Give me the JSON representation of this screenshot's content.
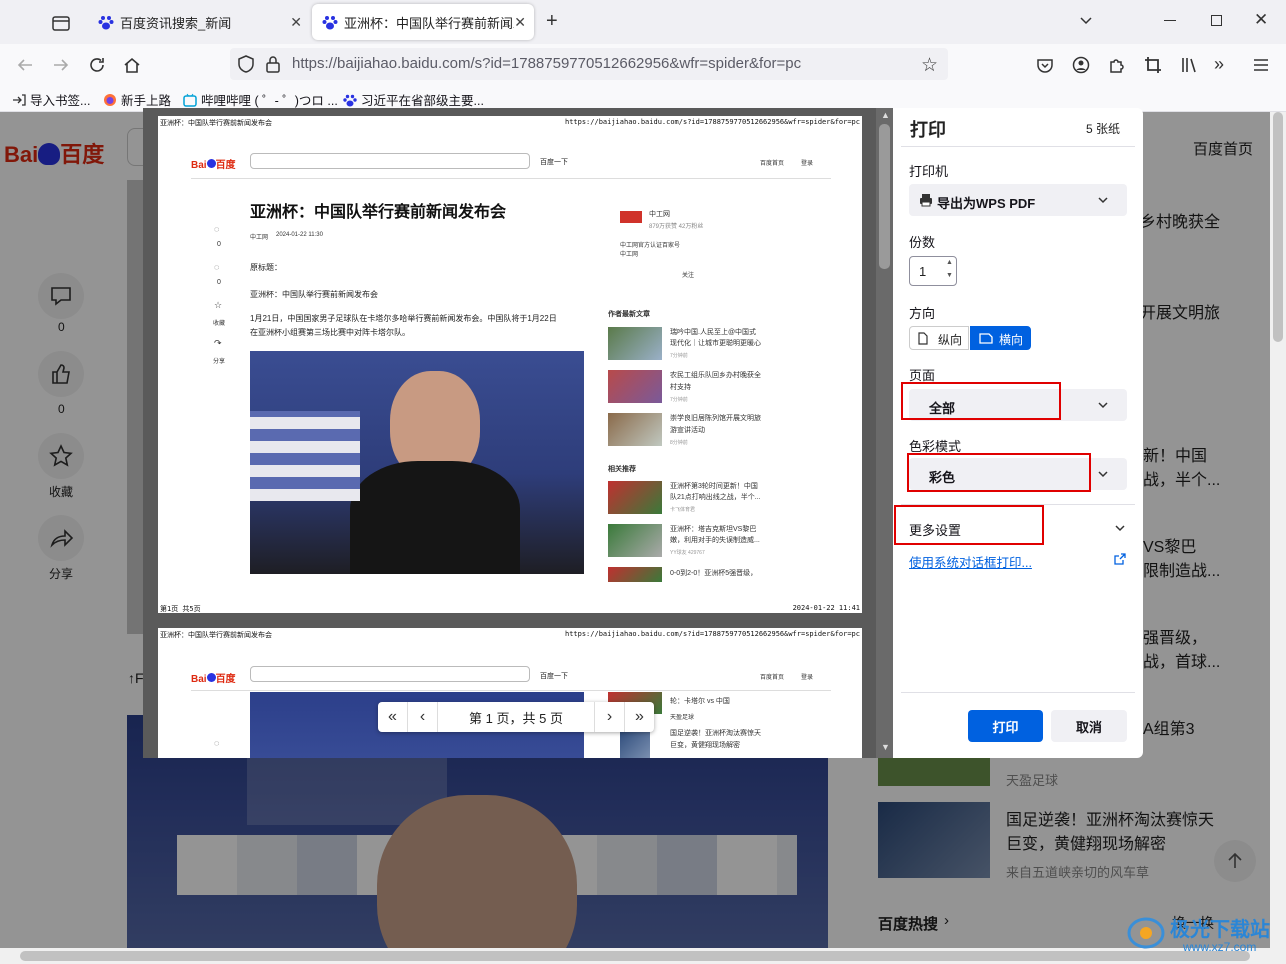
{
  "browser": {
    "tabs": [
      {
        "label": "百度资讯搜索_新闻"
      },
      {
        "label": "亚洲杯：中国队举行赛前新闻发"
      }
    ],
    "url_domain": "https://baijiahao.baidu.com",
    "url_rest": "/s?id=1788759770512662956&wfr=spider&for=pc",
    "bookmarks": [
      {
        "label": "导入书签..."
      },
      {
        "label": "新手上路"
      },
      {
        "label": "哔哩哔哩 ( ゜- ゜)つロ ..."
      },
      {
        "label": "习近平在省部级主要..."
      }
    ]
  },
  "background_page": {
    "logo": "Bai",
    "logo2": "百度",
    "home_link": "百度首页",
    "side_actions": [
      {
        "count": "0"
      },
      {
        "count": "0"
      },
      {
        "label": "收藏"
      },
      {
        "label": "分享"
      }
    ],
    "right_snippets": [
      "乡村晚获全",
      "开展文明旅",
      "新！中国",
      "战，半个...",
      "VS黎巴",
      "限制造战...",
      "强晋级，",
      "战，首球...",
      "A组第3"
    ],
    "news2_title_line1": "国足逆袭！亚洲杯淘汰赛惊天",
    "news2_title_line2": "巨变，黄健翔现场解密",
    "news2_source": "来自五道峡亲切的风车草",
    "news1_source": "天盈足球",
    "hot_search": "百度热搜",
    "hot_more": "换一换",
    "left_cut": "↑F"
  },
  "preview": {
    "header_left": "亚洲杯：中国队举行赛前新闻发布会",
    "header_right": "https://baijiahao.baidu.com/s?id=1788759770512662956&wfr=spider&for=pc",
    "search_btn": "百度一下",
    "nav_links": [
      "百度首页",
      "登录"
    ],
    "article_title": "亚洲杯：中国队举行赛前新闻发布会",
    "article_source": "中工网",
    "article_time": "2024-01-22 11:30",
    "para_label": "原标题：",
    "para1": "亚洲杯：中国队举行赛前新闻发布会",
    "para2_line1": "1月21日，中国国家男子足球队在卡塔尔多哈举行赛前新闻发布会。中国队将于1月22日",
    "para2_line2": "在亚洲杯小组赛第三场比赛中对阵卡塔尔队。",
    "author_name": "中工网",
    "author_stats": "879万获赞 42万粉丝",
    "author_desc1": "中工网官方认证百家号",
    "author_desc2": "中工网",
    "follow": "关注",
    "author_news_title": "作者最新文章",
    "author_news": [
      {
        "t1": "瑞吟中国.人民至上@中国式",
        "t2": "现代化｜让城市更聪明更暖心",
        "time": "7分钟前"
      },
      {
        "t1": "农民工组乐队回乡办村晚获全",
        "t2": "村支持",
        "time": "7分钟前"
      },
      {
        "t1": "崇学良旧居陈列馆开展文明旅",
        "t2": "游宣讲活动",
        "time": "8分钟前"
      }
    ],
    "related_title": "相关推荐",
    "related": [
      {
        "t1": "亚洲杯第3轮时间更新！中国",
        "t2": "队21点打响出线之战，半个...",
        "src": "卡飞体育君"
      },
      {
        "t1": "亚洲杯：塔吉克斯坦VS黎巴",
        "t2": "嫩，利用对手的失误制造威...",
        "src": "YY球友  429767"
      },
      {
        "t1": "0-0到2-0！亚洲杯5强晋级，",
        "t2": "",
        "src": ""
      }
    ],
    "side_counts": [
      "0",
      "0"
    ],
    "side_labels": [
      "收藏",
      "分享"
    ],
    "footer_left": "第1页 共5页",
    "footer_right": "2024-01-22 11:41",
    "page2_news": [
      {
        "t1": "轮：卡塔尔 vs 中国",
        "t2": "天盈足球"
      },
      {
        "t1": "国足逆袭！亚洲杯淘汰赛惊天",
        "t2": "巨变，黄健翔现场解密"
      }
    ],
    "pager_text": "第 1 页，共 5 页"
  },
  "print_panel": {
    "title": "打印",
    "sheets": "5 张纸",
    "printer_label": "打印机",
    "printer_value": "导出为WPS PDF",
    "copies_label": "份数",
    "copies_value": "1",
    "orientation_label": "方向",
    "portrait": "纵向",
    "landscape": "横向",
    "pages_label": "页面",
    "pages_value": "全部",
    "color_label": "色彩模式",
    "color_value": "彩色",
    "more_settings": "更多设置",
    "system_dialog": "使用系统对话框打印...",
    "print_btn": "打印",
    "cancel_btn": "取消"
  },
  "watermark": {
    "name": "极光下载站",
    "url": "www.xz7.com"
  },
  "colors": {
    "accent": "#0061e0",
    "highlight": "#e00000",
    "baidu_red": "#de2910",
    "baidu_blue": "#2932e1"
  }
}
